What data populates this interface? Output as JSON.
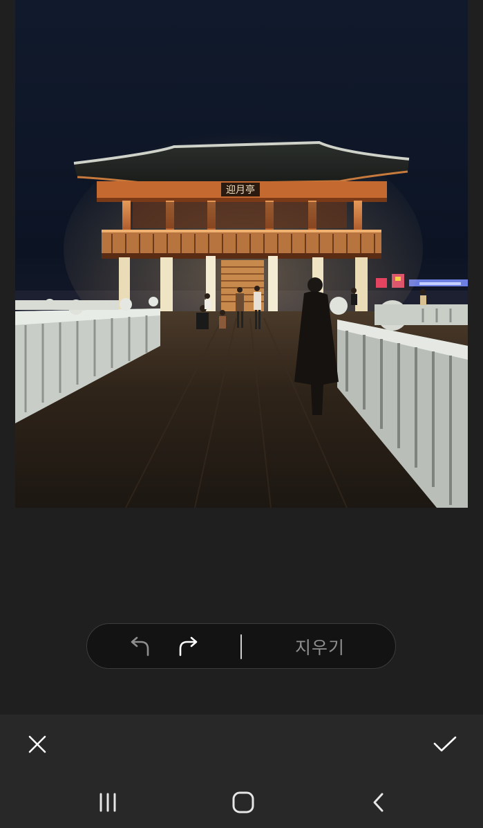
{
  "photo": {
    "subject": "",
    "sign_text": "迎月亭"
  },
  "toolbar": {
    "undo_icon": "undo-arrow-icon",
    "redo_icon": "redo-arrow-icon",
    "erase_label": "지우기"
  },
  "actions": {
    "cancel_icon": "close-icon",
    "confirm_icon": "check-icon"
  },
  "nav": {
    "recents_icon": "recent-apps-icon",
    "home_icon": "home-icon",
    "back_icon": "back-chevron-icon"
  },
  "colors": {
    "background": "#1f1f1f",
    "action_bar": "#282828",
    "icon_active": "#ffffff",
    "icon_disabled": "#8f8f8f"
  }
}
